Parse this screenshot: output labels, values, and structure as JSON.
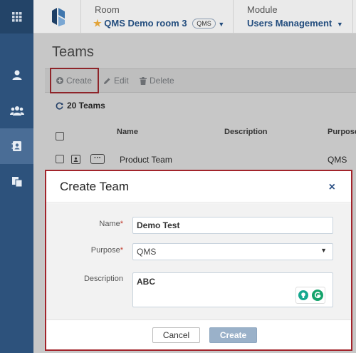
{
  "header": {
    "room_label": "Room",
    "room_value": "QMS Demo room 3",
    "room_badge": "QMS",
    "module_label": "Module",
    "module_value": "Users Management"
  },
  "sidebar": {
    "items": [
      {
        "icon": "grid-icon"
      },
      {
        "icon": "user-icon"
      },
      {
        "icon": "users-icon"
      },
      {
        "icon": "contact-card-icon"
      },
      {
        "icon": "documents-icon"
      }
    ]
  },
  "page": {
    "title": "Teams",
    "toolbar": {
      "create": "Create",
      "edit": "Edit",
      "delete": "Delete"
    },
    "count": "20 Teams",
    "columns": [
      "Name",
      "Description",
      "Purpose"
    ],
    "rows": [
      {
        "name": "Product Team",
        "description": "",
        "purpose": "QMS"
      }
    ]
  },
  "modal": {
    "title": "Create Team",
    "close": "×",
    "fields": {
      "name_label": "Name",
      "name_value": "Demo Test",
      "purpose_label": "Purpose",
      "purpose_value": "QMS",
      "description_label": "Description",
      "description_value": "ABC",
      "required_mark": "*"
    },
    "cancel": "Cancel",
    "create": "Create"
  }
}
